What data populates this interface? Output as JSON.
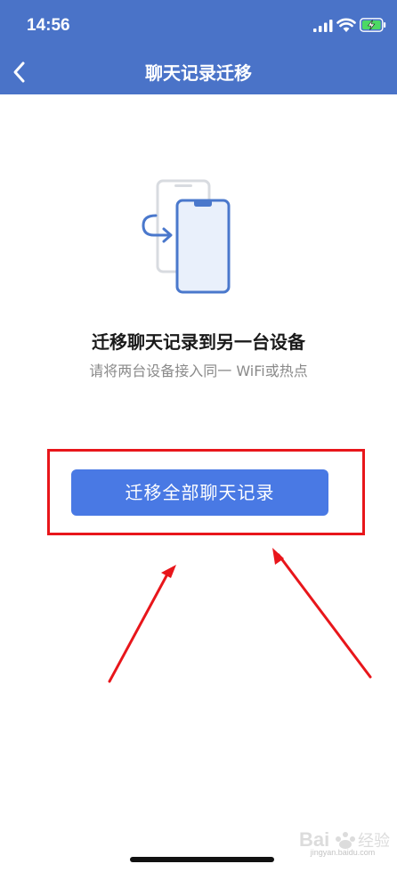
{
  "status_bar": {
    "time": "14:56",
    "icons": [
      "signal-icon",
      "wifi-icon",
      "battery-charging-icon"
    ]
  },
  "nav": {
    "back_icon": "chevron-left-icon",
    "title": "聊天记录迁移"
  },
  "main": {
    "illustration_icon": "phone-transfer-icon",
    "headline": "迁移聊天记录到另一台设备",
    "subtext": "请将两台设备接入同一 WiFi或热点",
    "button_label": "迁移全部聊天记录"
  },
  "watermark": {
    "text": "jingyan.baidu.com"
  },
  "colors": {
    "header": "#4a73c8",
    "button": "#4979e4",
    "annotation": "#e8161b"
  }
}
